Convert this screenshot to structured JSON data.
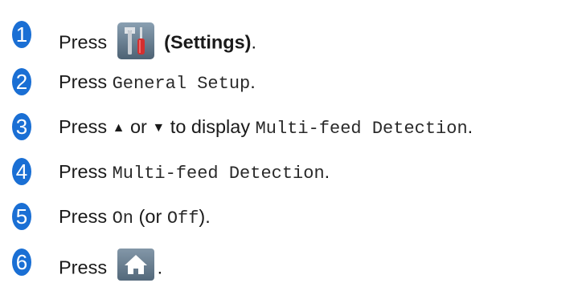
{
  "steps": [
    {
      "number": "1",
      "prefix": "Press",
      "label": "(Settings)",
      "suffix": ".",
      "icon": "settings-icon"
    },
    {
      "number": "2",
      "prefix": "Press",
      "code": "General Setup",
      "suffix": "."
    },
    {
      "number": "3",
      "prefix": "Press",
      "up_glyph": "▲",
      "or": "or",
      "down_glyph": "▼",
      "middle": "to display",
      "code": "Multi-feed Detection",
      "suffix": "."
    },
    {
      "number": "4",
      "prefix": "Press",
      "code": "Multi-feed Detection",
      "suffix": "."
    },
    {
      "number": "5",
      "prefix": "Press",
      "code_on": "On",
      "open": "(or",
      "code_off": "Off",
      "close": ")."
    },
    {
      "number": "6",
      "prefix": "Press",
      "suffix": ".",
      "icon": "home-icon"
    }
  ],
  "colors": {
    "badge": "#1a6fd4",
    "settings_icon_bg": "#5e7385",
    "home_icon_bg": "#6b7f90"
  }
}
